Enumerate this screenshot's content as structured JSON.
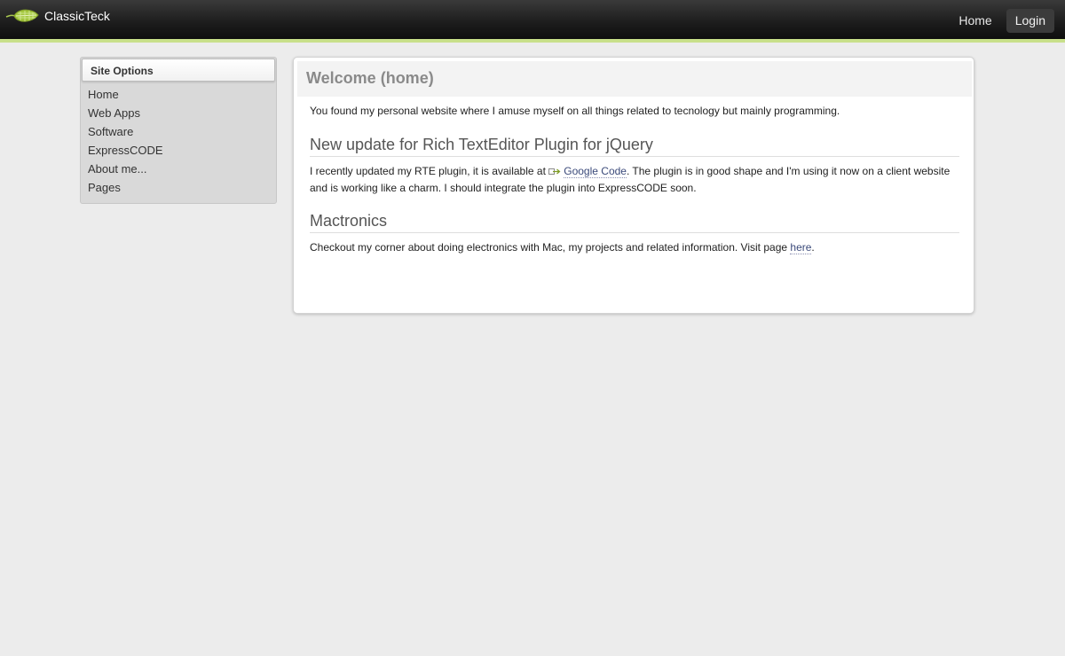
{
  "header": {
    "brand_name": "ClassicTeck",
    "nav": [
      {
        "label": "Home",
        "active": false
      },
      {
        "label": "Login",
        "active": true
      }
    ],
    "accent_color": "#c8e08a"
  },
  "sidebar": {
    "title": "Site Options",
    "items": [
      {
        "label": "Home"
      },
      {
        "label": "Web Apps"
      },
      {
        "label": "Software"
      },
      {
        "label": "ExpressCODE"
      },
      {
        "label": "About me..."
      },
      {
        "label": "Pages"
      }
    ]
  },
  "main": {
    "title": "Welcome (home)",
    "intro": "You found my personal website where I amuse myself on all things related to tecnology but mainly programming.",
    "sections": [
      {
        "heading": "New update for Rich TextEditor Plugin for jQuery",
        "text_before": "I recently updated my RTE plugin, it is available at ",
        "link_label": "Google Code",
        "link_icon": "external-link-icon",
        "text_after": ". The plugin is in good shape and I'm using it now on a client website and is working like a charm. I should integrate the plugin into ExpressCODE soon."
      },
      {
        "heading": "Mactronics",
        "text_before": "Checkout my corner about doing electronics with Mac, my projects and related information. Visit page ",
        "link_label": "here",
        "text_after": "."
      }
    ]
  },
  "icons": {
    "logo": "leaf-logo-icon",
    "external": "external-link-icon"
  }
}
